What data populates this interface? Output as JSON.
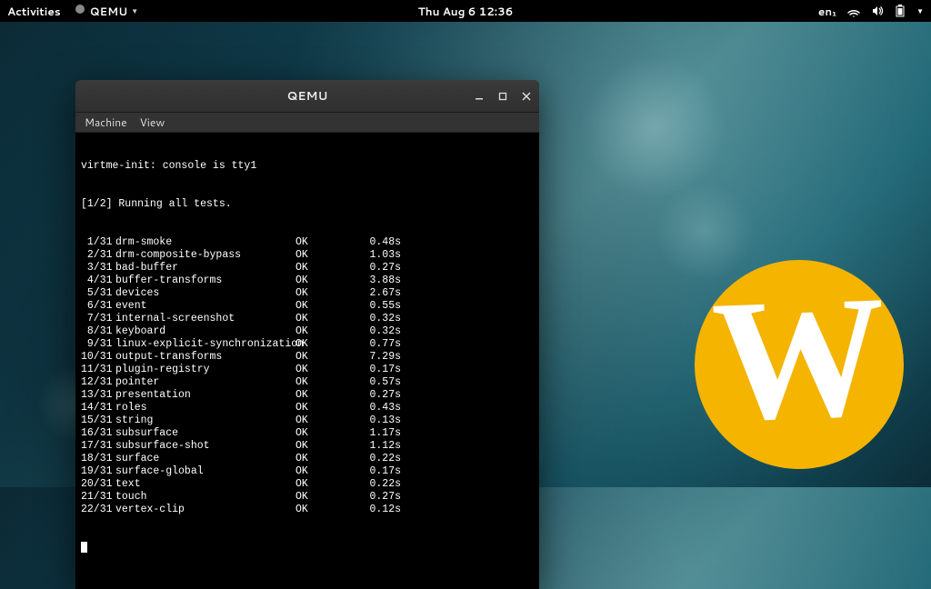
{
  "panel": {
    "activities": "Activities",
    "app_name": "QEMU",
    "datetime": "Thu Aug 6  12:36",
    "lang": "en₁"
  },
  "window": {
    "title": "QEMU",
    "menus": {
      "machine": "Machine",
      "view": "View"
    }
  },
  "terminal": {
    "line1": "virtme-init: console is tty1",
    "line2": "[1/2] Running all tests.",
    "tests": [
      {
        "idx": " 1/31",
        "name": "drm-smoke",
        "status": "OK",
        "time": "0.48s"
      },
      {
        "idx": " 2/31",
        "name": "drm-composite-bypass",
        "status": "OK",
        "time": "1.03s"
      },
      {
        "idx": " 3/31",
        "name": "bad-buffer",
        "status": "OK",
        "time": "0.27s"
      },
      {
        "idx": " 4/31",
        "name": "buffer-transforms",
        "status": "OK",
        "time": "3.88s"
      },
      {
        "idx": " 5/31",
        "name": "devices",
        "status": "OK",
        "time": "2.67s"
      },
      {
        "idx": " 6/31",
        "name": "event",
        "status": "OK",
        "time": "0.55s"
      },
      {
        "idx": " 7/31",
        "name": "internal-screenshot",
        "status": "OK",
        "time": "0.32s"
      },
      {
        "idx": " 8/31",
        "name": "keyboard",
        "status": "OK",
        "time": "0.32s"
      },
      {
        "idx": " 9/31",
        "name": "linux-explicit-synchronization",
        "status": "OK",
        "time": "0.77s"
      },
      {
        "idx": "10/31",
        "name": "output-transforms",
        "status": "OK",
        "time": "7.29s"
      },
      {
        "idx": "11/31",
        "name": "plugin-registry",
        "status": "OK",
        "time": "0.17s"
      },
      {
        "idx": "12/31",
        "name": "pointer",
        "status": "OK",
        "time": "0.57s"
      },
      {
        "idx": "13/31",
        "name": "presentation",
        "status": "OK",
        "time": "0.27s"
      },
      {
        "idx": "14/31",
        "name": "roles",
        "status": "OK",
        "time": "0.43s"
      },
      {
        "idx": "15/31",
        "name": "string",
        "status": "OK",
        "time": "0.13s"
      },
      {
        "idx": "16/31",
        "name": "subsurface",
        "status": "OK",
        "time": "1.17s"
      },
      {
        "idx": "17/31",
        "name": "subsurface-shot",
        "status": "OK",
        "time": "1.12s"
      },
      {
        "idx": "18/31",
        "name": "surface",
        "status": "OK",
        "time": "0.22s"
      },
      {
        "idx": "19/31",
        "name": "surface-global",
        "status": "OK",
        "time": "0.17s"
      },
      {
        "idx": "20/31",
        "name": "text",
        "status": "OK",
        "time": "0.22s"
      },
      {
        "idx": "21/31",
        "name": "touch",
        "status": "OK",
        "time": "0.27s"
      },
      {
        "idx": "22/31",
        "name": "vertex-clip",
        "status": "OK",
        "time": "0.12s"
      }
    ]
  },
  "logo": {
    "letter": "W"
  }
}
